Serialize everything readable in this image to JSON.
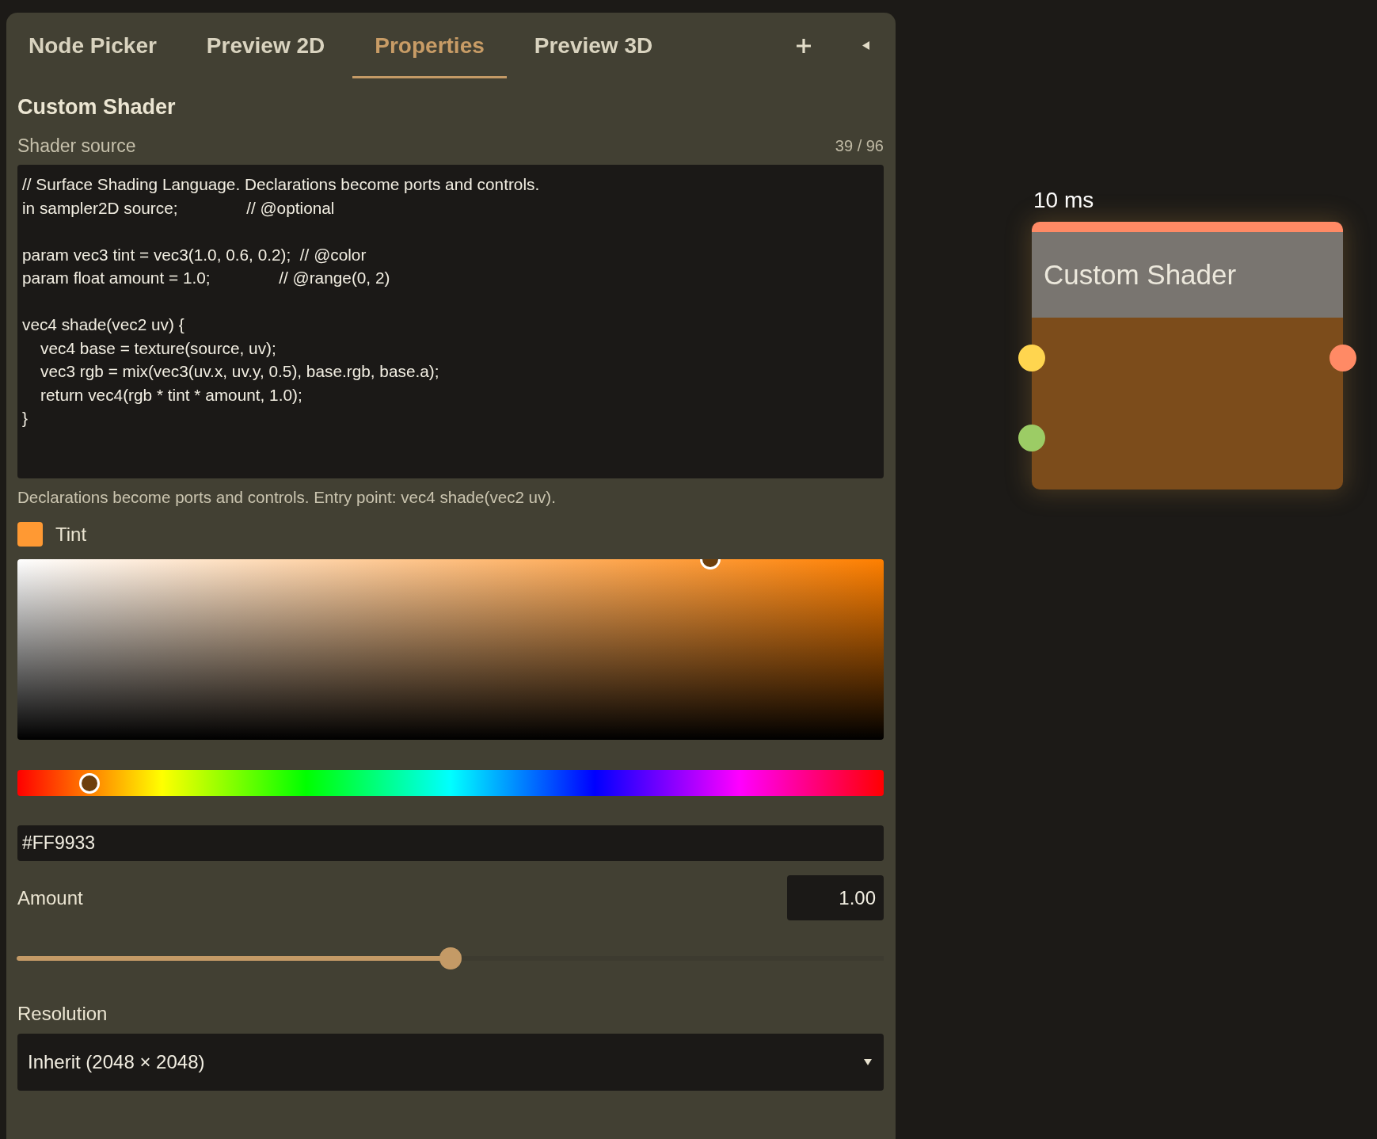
{
  "panel": {
    "tabs": [
      {
        "label": "Node Picker",
        "selected": false
      },
      {
        "label": "Preview 2D",
        "selected": false
      },
      {
        "label": "Properties",
        "selected": true
      },
      {
        "label": "Preview 3D",
        "selected": false
      }
    ]
  },
  "properties": {
    "title": "Custom Shader",
    "shader_source": {
      "label": "Shader source",
      "counter": "39 / 96",
      "value": "// Surface Shading Language. Declarations become ports and controls.\nin sampler2D source;               // @optional\n\nparam vec3 tint = vec3(1.0, 0.6, 0.2);  // @color\nparam float amount = 1.0;               // @range(0, 2)\n\nvec4 shade(vec2 uv) {\n    vec4 base = texture(source, uv);\n    vec3 rgb = mix(vec3(uv.x, uv.y, 0.5), base.rgb, base.a);\n    return vec4(rgb * tint * amount, 1.0);\n}",
      "hint": "Declarations become ports and controls. Entry point: vec4 shade(vec2 uv)."
    },
    "tint": {
      "label": "Tint",
      "color": "#ff9933",
      "hue_slider": {
        "level": 0.083
      },
      "hex": "#FF9933"
    },
    "amount": {
      "label": "Amount",
      "value": "1.00",
      "level": 0.5
    },
    "resolution": {
      "label": "Resolution",
      "value": "Inherit (2048 × 2048)"
    }
  },
  "canvas": {
    "node": {
      "timing": "10 ms",
      "title": "Custom Shader",
      "inputs": [
        {
          "color": "#ffd54f"
        },
        {
          "color": "#9ccc65"
        }
      ],
      "outputs": [
        {
          "color": "#ff8a65"
        }
      ]
    }
  }
}
